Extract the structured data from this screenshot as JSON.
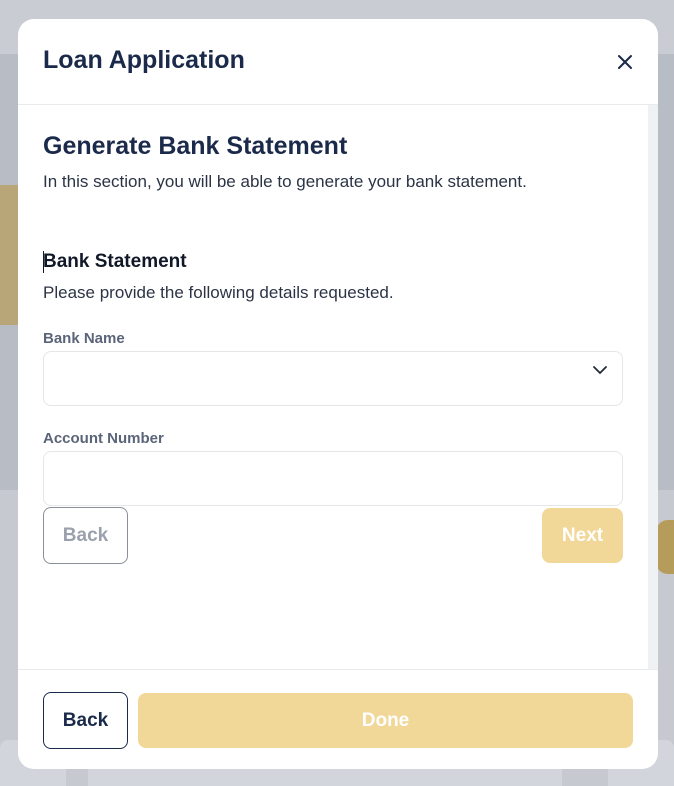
{
  "modal": {
    "title": "Loan Application"
  },
  "section": {
    "title": "Generate Bank Statement",
    "description": "In this section, you will be able to generate your bank statement."
  },
  "subsection": {
    "title": "Bank Statement",
    "description": "Please provide the following details requested."
  },
  "form": {
    "bank_name_label": "Bank Name",
    "bank_name_value": "",
    "account_number_label": "Account Number",
    "account_number_value": "",
    "account_number_placeholder": ""
  },
  "step_buttons": {
    "back_label": "Back",
    "next_label": "Next"
  },
  "footer": {
    "back_label": "Back",
    "done_label": "Done"
  },
  "colors": {
    "primary_navy": "#1b2a4a",
    "accent_gold_disabled": "#f1d898"
  },
  "icons": {
    "close": "close-icon",
    "dropdown": "chevron-down-icon"
  }
}
